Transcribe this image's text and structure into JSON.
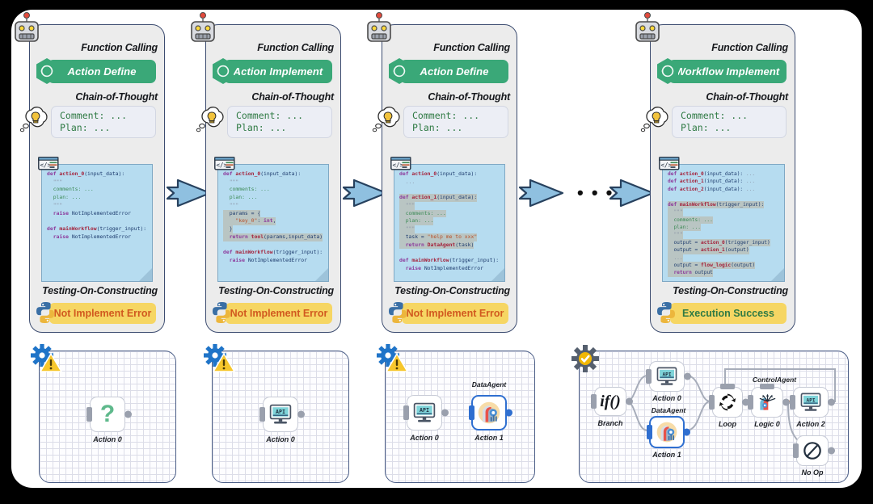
{
  "meta": {
    "dots_between_panels": "• • •"
  },
  "stages": [
    {
      "id": "stage-1",
      "robot_icon": "robot-icon",
      "function_calling_title": "Function Calling",
      "function_calling_action": "Action Define",
      "openai_icon": "openai-logo-icon",
      "cot_title": "Chain-of-Thought",
      "thought_icon": "thought-bubble-icon",
      "cot_lines": [
        "Comment: ...",
        "Plan: ..."
      ],
      "code_icon": "code-file-icon",
      "testing_title": "Testing-On-Constructing",
      "python_icon": "python-icon",
      "status_label": "Not Implement Error",
      "status_kind": "err"
    },
    {
      "id": "stage-2",
      "robot_icon": "robot-icon",
      "function_calling_title": "Function Calling",
      "function_calling_action": "Action Implement",
      "openai_icon": "openai-logo-icon",
      "cot_title": "Chain-of-Thought",
      "thought_icon": "thought-bubble-icon",
      "cot_lines": [
        "Comment: ...",
        "Plan: ..."
      ],
      "code_icon": "code-file-icon",
      "testing_title": "Testing-On-Constructing",
      "python_icon": "python-icon",
      "status_label": "Not Implement Error",
      "status_kind": "err"
    },
    {
      "id": "stage-3",
      "robot_icon": "robot-icon",
      "function_calling_title": "Function Calling",
      "function_calling_action": "Action Define",
      "openai_icon": "openai-logo-icon",
      "cot_title": "Chain-of-Thought",
      "thought_icon": "thought-bubble-icon",
      "cot_lines": [
        "Comment: ...",
        "Plan: ..."
      ],
      "code_icon": "code-file-icon",
      "testing_title": "Testing-On-Constructing",
      "python_icon": "python-icon",
      "status_label": "Not Implement Error",
      "status_kind": "err"
    },
    {
      "id": "stage-4",
      "robot_icon": "robot-icon",
      "function_calling_title": "Function Calling",
      "function_calling_action": "Workflow Implement",
      "openai_icon": "openai-logo-icon",
      "cot_title": "Chain-of-Thought",
      "thought_icon": "thought-bubble-icon",
      "cot_lines": [
        "Comment: ...",
        "Plan: ..."
      ],
      "code_icon": "code-file-icon",
      "testing_title": "Testing-On-Constructing",
      "python_icon": "python-icon",
      "status_label": "Execution Success",
      "status_kind": "ok"
    }
  ],
  "code_blocks": {
    "block1_lines": [
      "def action_0(input_data):",
      "  \"\"\"",
      "  comments: ...",
      "  plan: ...",
      "  \"\"\"",
      "  raise NotImplementedError",
      "",
      "def mainWorkflow(trigger_input):",
      "  raise NotImplementedError"
    ],
    "block2_lines": [
      "def action_0(input_data):",
      "  \"\"\"",
      "  comments: ...",
      "  plan: ...",
      "  \"\"\"",
      "  params = {",
      "    \"key_0\": int,",
      "  }",
      "  return tool(params,input_data)",
      "",
      "def mainWorkflow(trigger_input):",
      "  raise NotImplementedError"
    ],
    "block3_lines": [
      "def action_0(input_data):",
      "  ...",
      "",
      "def action_1(input_data):",
      "  \"\"\"",
      "  comments: ...",
      "  plan: ...",
      "  \"\"\"",
      "  task = \"help me to xxx\"",
      "  return DataAgent(task)",
      "",
      "def mainWorkflow(trigger_input):",
      "  raise NotImplementedError"
    ],
    "block4_lines": [
      "def action_0(input_data): ...",
      "def action_1(input_data): ...",
      "def action_2(input_data): ...",
      "",
      "def mainWorkflow(trigger_input):",
      "  \"\"\"",
      "  comments: ...",
      "  plan: ...",
      "  \"\"\"",
      "  output = action_0(trigger_input)",
      "  output = action_1(output)",
      "  ...",
      "  output = flow_logic(output)",
      "  return output"
    ]
  },
  "canvases": [
    {
      "id": "canvas-1",
      "gear_icon": "gear-warning-icon",
      "status": "warning",
      "nodes": [
        {
          "name": "node-action-0",
          "label": "Action 0",
          "top_label": "",
          "icon": "question-mark-icon",
          "selected": false
        }
      ]
    },
    {
      "id": "canvas-2",
      "gear_icon": "gear-warning-icon",
      "status": "warning",
      "nodes": [
        {
          "name": "node-action-0",
          "label": "Action 0",
          "top_label": "",
          "icon": "api-monitor-icon",
          "selected": false
        }
      ]
    },
    {
      "id": "canvas-3",
      "gear_icon": "gear-warning-icon",
      "status": "warning",
      "nodes": [
        {
          "name": "node-action-0",
          "label": "Action 0",
          "top_label": "",
          "icon": "api-monitor-icon",
          "selected": false
        },
        {
          "name": "node-action-1",
          "label": "Action 1",
          "top_label": "DataAgent",
          "icon": "data-agent-icon",
          "selected": true
        }
      ]
    },
    {
      "id": "canvas-4",
      "gear_icon": "gear-check-icon",
      "status": "success",
      "nodes": [
        {
          "name": "node-branch",
          "label": "Branch",
          "top_label": "",
          "icon": "if-branch-icon",
          "selected": false
        },
        {
          "name": "node-action-0",
          "label": "Action 0",
          "top_label": "",
          "icon": "api-monitor-icon",
          "selected": false
        },
        {
          "name": "node-action-1",
          "label": "Action 1",
          "top_label": "DataAgent",
          "icon": "data-agent-icon",
          "selected": true
        },
        {
          "name": "node-loop",
          "label": "Loop",
          "top_label": "",
          "icon": "loop-refresh-icon",
          "selected": false
        },
        {
          "name": "node-logic-0",
          "label": "Logic 0",
          "top_label": "ControlAgent",
          "icon": "control-agent-icon",
          "selected": false
        },
        {
          "name": "node-action-2",
          "label": "Action 2",
          "top_label": "",
          "icon": "api-monitor-icon",
          "selected": false
        },
        {
          "name": "node-no-op",
          "label": "No Op",
          "top_label": "",
          "icon": "no-op-icon",
          "selected": false
        }
      ]
    }
  ],
  "colors": {
    "accent_green": "#3aa878",
    "badge_yellow": "#f6d663",
    "error_text": "#d1591f",
    "success_text": "#2f7a44",
    "panel_border": "#3c4c70",
    "code_bg": "#b6dcf0",
    "arrow_fill": "#8fc0e0",
    "select_blue": "#2f6fd0"
  }
}
